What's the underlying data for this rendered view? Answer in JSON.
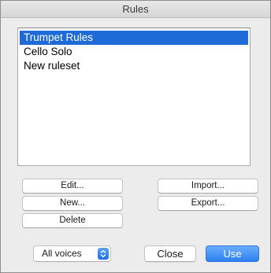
{
  "window": {
    "title": "Rules"
  },
  "rules_list": {
    "items": [
      {
        "label": "Trumpet Rules",
        "selected": true
      },
      {
        "label": "Cello Solo",
        "selected": false
      },
      {
        "label": "New ruleset",
        "selected": false
      }
    ]
  },
  "buttons": {
    "edit": "Edit...",
    "new": "New...",
    "delete": "Delete",
    "import": "Import...",
    "export": "Export...",
    "close": "Close",
    "use": "Use"
  },
  "voices_popup": {
    "selected": "All voices",
    "icon": "up-down-chevron-icon"
  },
  "colors": {
    "selection": "#1d6ad8",
    "default_button": "#2c7ff0"
  }
}
